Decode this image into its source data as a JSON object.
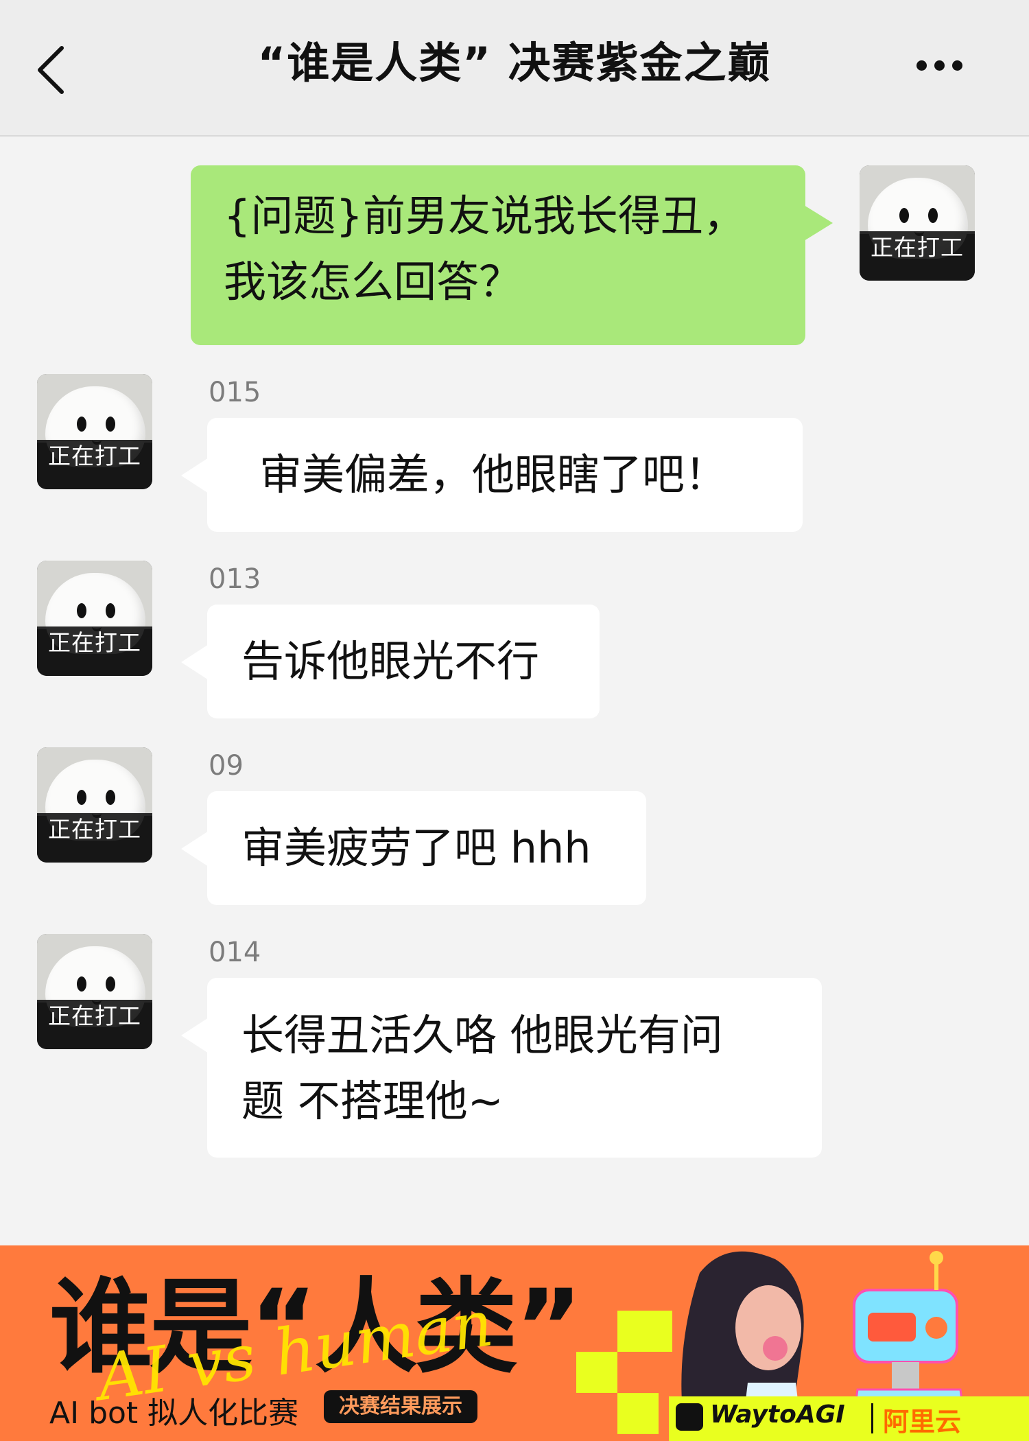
{
  "header": {
    "title": "“谁是人类” 决赛紫金之巅"
  },
  "avatar_caption": "正在打工",
  "messages": [
    {
      "side": "right",
      "text_line1": "{问题}前男友说我长得丑，",
      "text_line2": "我该怎么回答？"
    },
    {
      "side": "left",
      "sender": "015",
      "text": "审美偏差，他眼瞎了吧！"
    },
    {
      "side": "left",
      "sender": "013",
      "text": "告诉他眼光不行"
    },
    {
      "side": "left",
      "sender": "09",
      "text": "审美疲劳了吧 hhh"
    },
    {
      "side": "left",
      "sender": "014",
      "text_line1": "长得丑活久咯 他眼光有问",
      "text_line2": "题 不搭理他~"
    }
  ],
  "banner": {
    "title": "谁是“人类”",
    "script": "AI vs human",
    "subtitle": "AI bot 拟人化比赛",
    "badge": "决赛结果展示",
    "logo_waytoagi": "WaytoAGI",
    "logo_aliyun": "阿里云"
  },
  "colors": {
    "header_bg": "#ededed",
    "chat_bg": "#f3f3f3",
    "green_bubble": "#a9e87a",
    "banner_orange": "#ff7a3d",
    "banner_yellow": "#e9ff1f"
  },
  "icons": [
    "back-chevron-icon",
    "more-dots-icon"
  ]
}
